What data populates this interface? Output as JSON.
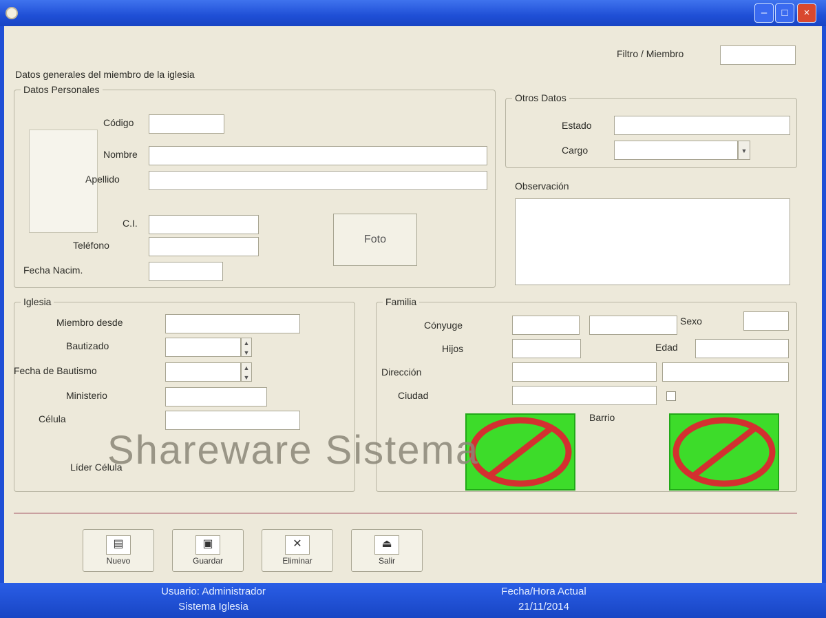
{
  "window": {
    "title": "",
    "system_icon": "app-icon",
    "controls": {
      "minimize": "–",
      "maximize": "□",
      "close": "×"
    }
  },
  "toolbar": {
    "filter_label": "Filtro / Miembro",
    "filter_value": "",
    "buttons": [
      {
        "label": "Nuevo",
        "icon": "new-document-icon"
      },
      {
        "label": "Guardar",
        "icon": "save-disk-icon"
      },
      {
        "label": "Eliminar",
        "icon": "delete-icon"
      },
      {
        "label": "Salir",
        "icon": "exit-door-icon"
      }
    ]
  },
  "form": {
    "header_text": "Datos generales del miembro de la iglesia",
    "personal": {
      "legend": "Datos Personales",
      "id_label": "Código",
      "first_name_label": "Nombre",
      "last_name_label": "Apellido",
      "ci_label": "C.I.",
      "phone_label": "Teléfono",
      "birth_label": "Fecha Nacim.",
      "photo_button_label": "Foto"
    },
    "extra": {
      "legend": "Otros Datos",
      "field1_label": "Estado",
      "field2_label": "Cargo",
      "notes_label": "Observación"
    },
    "church": {
      "legend": "Iglesia",
      "field1_label": "Miembro desde",
      "field2_label": "Bautizado",
      "field3_label": "Fecha de Bautismo",
      "field4_label": "Ministerio",
      "field5_label": "Célula",
      "field6_label": "Líder Célula"
    },
    "family": {
      "legend": "Familia",
      "field1_label": "Cónyuge",
      "field2_label": "Hijos",
      "field3_label": "Dirección",
      "field4_label": "Ciudad",
      "field5_label": "Barrio",
      "field6_label": "Sexo",
      "field7_label": "Edad"
    },
    "watermark": "Shareware Sistema"
  },
  "status": {
    "left_line1": "Usuario: Administrador",
    "left_line2": "Sistema Iglesia",
    "right_line1": "Fecha/Hora Actual",
    "right_line2": "21/11/2014"
  },
  "colors": {
    "titlebar": "#1f4fd6",
    "window_bg": "#ede9da",
    "disabled_icon_fill": "#3ddc2a",
    "disabled_icon_ring": "#d33030"
  }
}
